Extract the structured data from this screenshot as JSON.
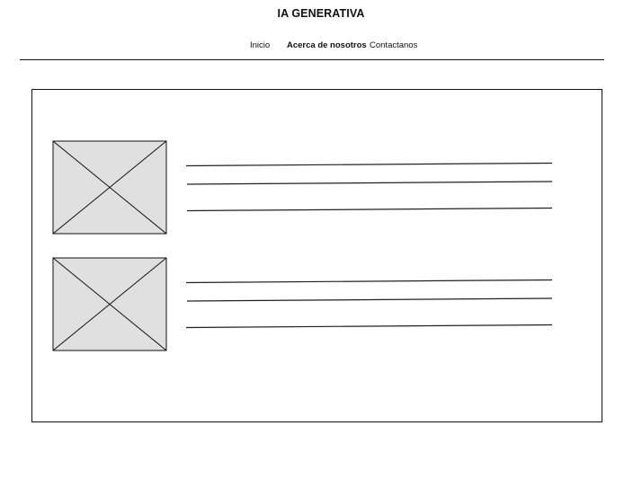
{
  "header": {
    "title": "IA GENERATIVA",
    "nav": [
      {
        "label": "Inicio",
        "active": false
      },
      {
        "label": "Acerca de nosotros",
        "active": true
      },
      {
        "label": "Contactanos",
        "active": false
      }
    ]
  },
  "main": {
    "items": [
      {
        "image": "image-placeholder",
        "text_lines": 3
      },
      {
        "image": "image-placeholder",
        "text_lines": 3
      }
    ]
  },
  "colors": {
    "placeholder_fill": "#e0e0e0",
    "stroke": "#111111",
    "background": "#ffffff"
  }
}
